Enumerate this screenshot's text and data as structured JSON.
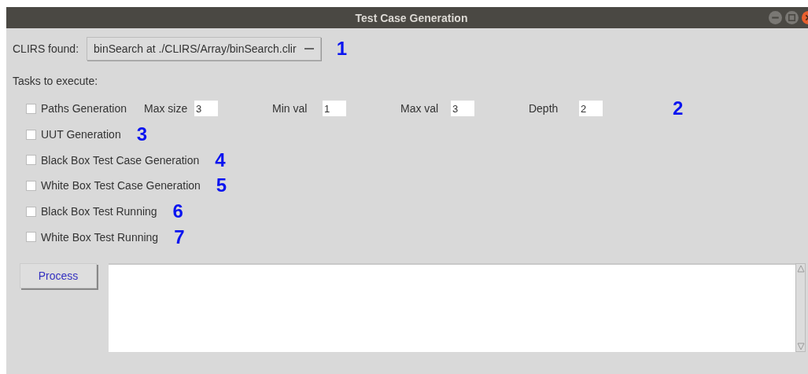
{
  "window": {
    "title": "Test Case Generation"
  },
  "clirs": {
    "label": "CLIRS found:",
    "value": "binSearch at  ./CLIRS/Array/binSearch.clir",
    "annotation": "1"
  },
  "tasks_label": "Tasks to execute:",
  "tasks": [
    {
      "label": "Paths Generation",
      "checked": false,
      "params": [
        {
          "label": "Max size",
          "value": "3"
        },
        {
          "label": "Min val",
          "value": "1"
        },
        {
          "label": "Max val",
          "value": "3"
        },
        {
          "label": "Depth",
          "value": "2"
        }
      ],
      "annotation": "2"
    },
    {
      "label": "UUT Generation",
      "checked": false,
      "annotation": "3"
    },
    {
      "label": "Black Box Test Case Generation",
      "checked": false,
      "annotation": "4"
    },
    {
      "label": "White Box Test Case Generation",
      "checked": false,
      "annotation": "5"
    },
    {
      "label": "Black Box Test Running",
      "checked": false,
      "annotation": "6"
    },
    {
      "label": "White Box Test Running",
      "checked": false,
      "annotation": "7"
    }
  ],
  "process_button": "Process"
}
